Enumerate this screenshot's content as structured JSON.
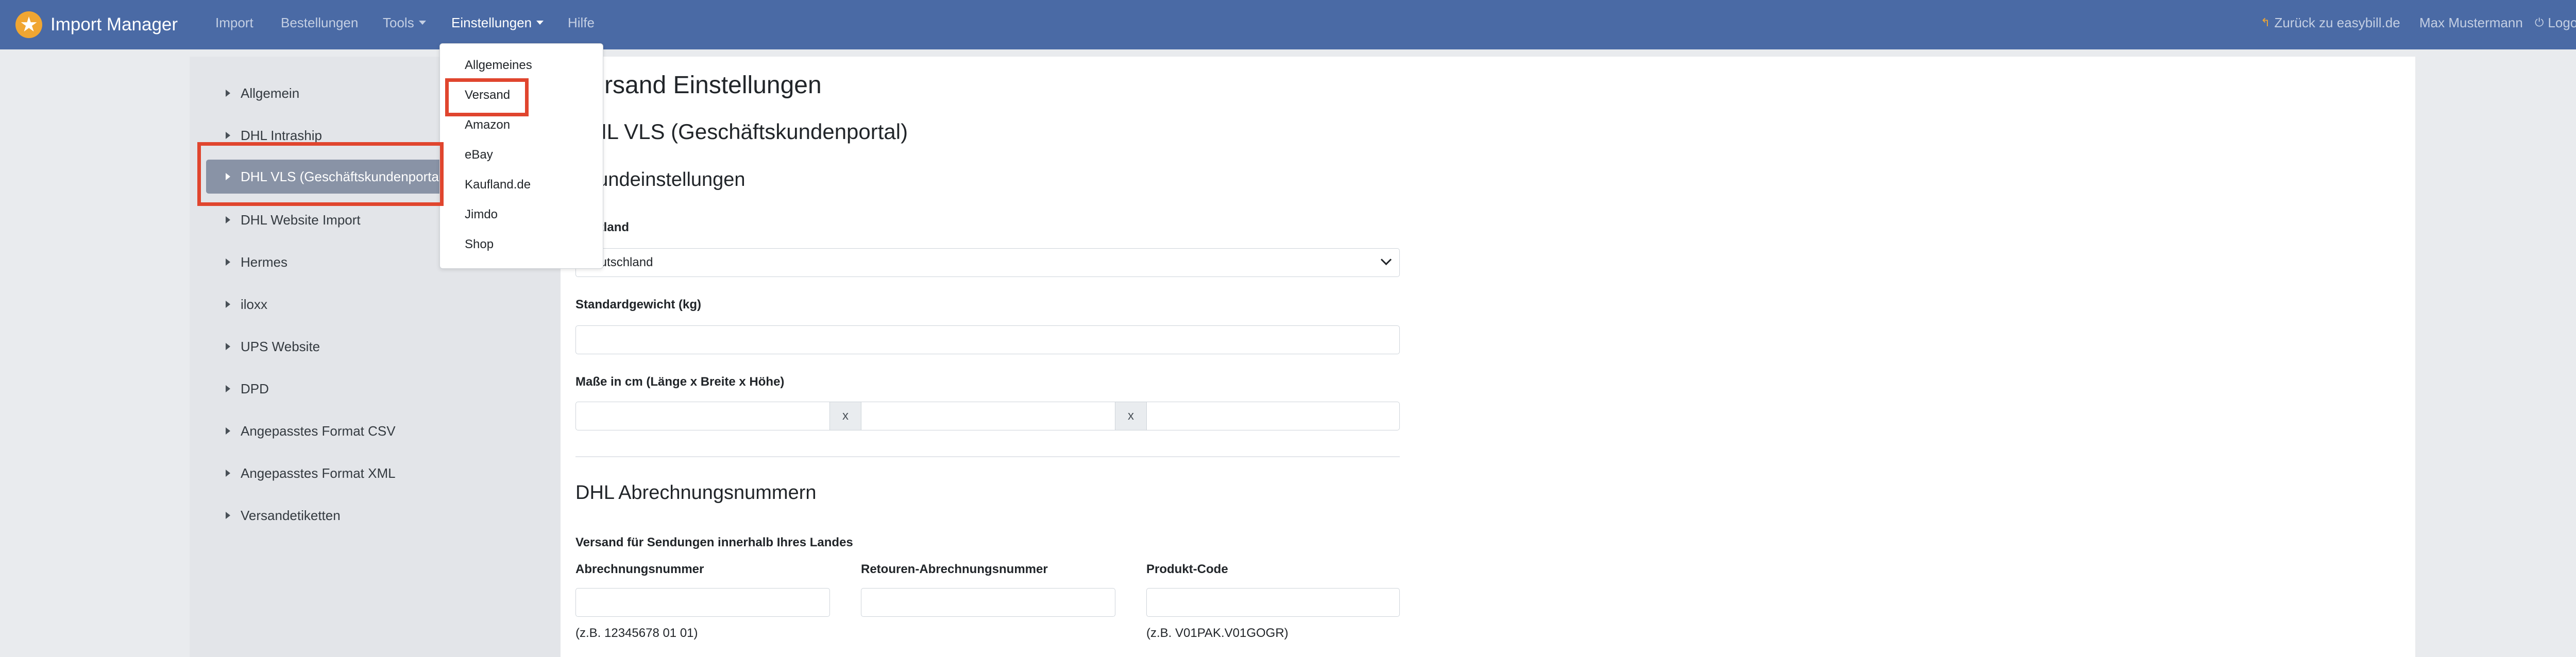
{
  "navbar": {
    "brand": "Import Manager",
    "brand_icon": "star-badge-icon",
    "items": [
      "Import",
      "Bestellungen",
      "Tools",
      "Einstellungen",
      "Hilfe"
    ],
    "active": "Einstellungen",
    "back_link": "Zurück zu easybill.de",
    "user": "Max Mustermann",
    "logout": "Logout"
  },
  "dropdown": {
    "items": [
      "Allgemeines",
      "Versand",
      "Amazon",
      "eBay",
      "Kaufland.de",
      "Jimdo",
      "Shop"
    ],
    "highlighted": "Versand"
  },
  "sidebar": {
    "items": [
      "Allgemein",
      "DHL Intraship",
      "DHL VLS (Geschäftskundenportal)",
      "DHL Website Import",
      "Hermes",
      "iloxx",
      "UPS Website",
      "DPD",
      "Angepasstes Format CSV",
      "Angepasstes Format XML",
      "Versandetiketten"
    ],
    "active": "DHL VLS (Geschäftskundenportal)"
  },
  "main": {
    "title": "Versand Einstellungen",
    "subtitle": "DHL VLS (Geschäftskundenportal)",
    "section1": "Grundeinstellungen",
    "startland_label": "Startland",
    "startland_value": "Deutschland",
    "weight_label": "Standardgewicht (kg)",
    "weight_value": "",
    "dims_label": "Maße in cm (Länge x Breite x Höhe)",
    "dims_sep": "x",
    "dims_values": [
      "",
      "",
      ""
    ],
    "section2": "DHL Abrechnungsnummern",
    "domestic_label": "Versand für Sendungen innerhalb Ihres Landes",
    "billing_label": "Abrechnungsnummer",
    "billing_value": "",
    "billing_help": "(z.B. 12345678 01 01)",
    "return_billing_label": "Retouren-Abrechnungsnummer",
    "return_billing_value": "",
    "product_code_label": "Produkt-Code",
    "product_code_value": "",
    "product_code_help": "(z.B. V01PAK.V01GOGR)"
  },
  "colors": {
    "navbar": "#4a6aa5",
    "highlight": "#e0452e",
    "sidebar_active": "#8993a6",
    "brand_icon": "#f0a632"
  }
}
